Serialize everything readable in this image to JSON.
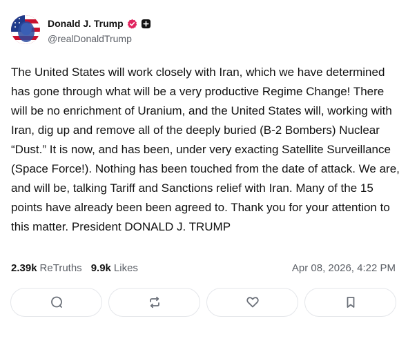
{
  "author": {
    "display_name": "Donald J. Trump",
    "handle": "@realDonaldTrump",
    "avatar_icon": "profile-photo",
    "verified_icon": "verified-badge-icon",
    "verified_color": "#e0245e",
    "plus_icon": "plus-badge-icon"
  },
  "post": {
    "text": "The United States will work closely with Iran, which we have determined has gone through what will be a very productive Regime Change! There will be no enrichment of Uranium, and the United States will, working with Iran, dig up and remove all of the deeply buried (B-2 Bombers) Nuclear “Dust.” It is now, and has been, under very exacting Satellite Surveillance (Space Force!). Nothing has been touched from the date of attack. We are, and will be, talking Tariff and Sanctions relief with Iran. Many of the 15 points have already been been agreed to. Thank you for your attention to this matter. President DONALD J. TRUMP"
  },
  "stats": {
    "retruths_count": "2.39k",
    "retruths_label": "ReTruths",
    "likes_count": "9.9k",
    "likes_label": "Likes",
    "timestamp": "Apr 08, 2026, 4:22 PM"
  },
  "actions": [
    {
      "icon": "reply-icon"
    },
    {
      "icon": "retruth-icon"
    },
    {
      "icon": "heart-icon"
    },
    {
      "icon": "bookmark-icon"
    }
  ],
  "colors": {
    "text": "#111111",
    "muted": "#5b5f66",
    "border": "#e4e6ea",
    "icon": "#6b7079"
  }
}
